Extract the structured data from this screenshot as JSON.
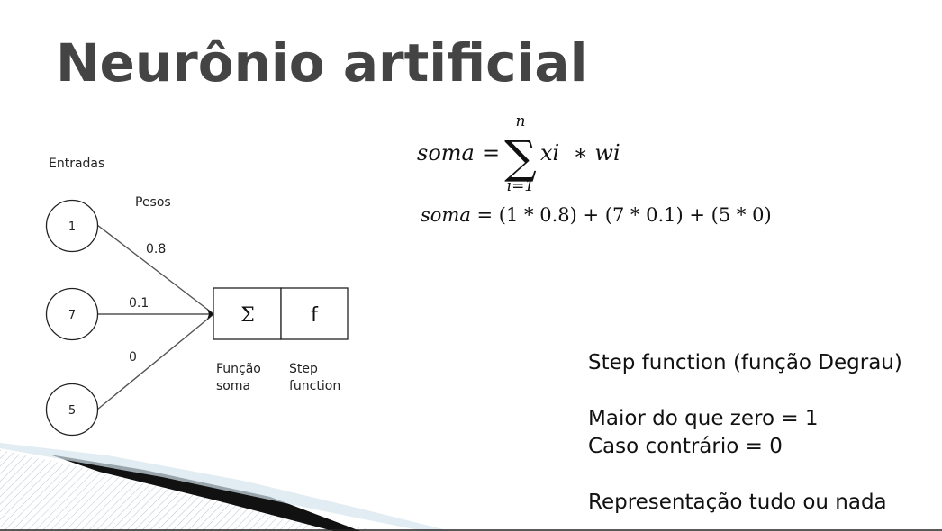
{
  "slide": {
    "title": "Neurônio artificial"
  },
  "diagram": {
    "inputs_label": "Entradas",
    "weights_label": "Pesos",
    "inputs": [
      {
        "value": "1",
        "weight": "0.8"
      },
      {
        "value": "7",
        "weight": "0.1"
      },
      {
        "value": "5",
        "weight": "0"
      }
    ],
    "sum_symbol": "Σ",
    "function_symbol": "f",
    "sum_caption": [
      "Função",
      "soma"
    ],
    "function_caption": [
      "Step",
      "function"
    ]
  },
  "formula": {
    "lhs": "soma",
    "equals": "=",
    "sum_upper": "n",
    "sum_lower": "i=1",
    "term": "xi  ∗ wi",
    "example_var": "soma",
    "example_rhs": " = (1 * 0.8) + (7 * 0.1) + (5 * 0)"
  },
  "notes": {
    "heading": "Step function (função Degrau)",
    "line1": "Maior do que zero = 1",
    "line2": "Caso contrário = 0",
    "line3": "Representação tudo ou nada"
  }
}
